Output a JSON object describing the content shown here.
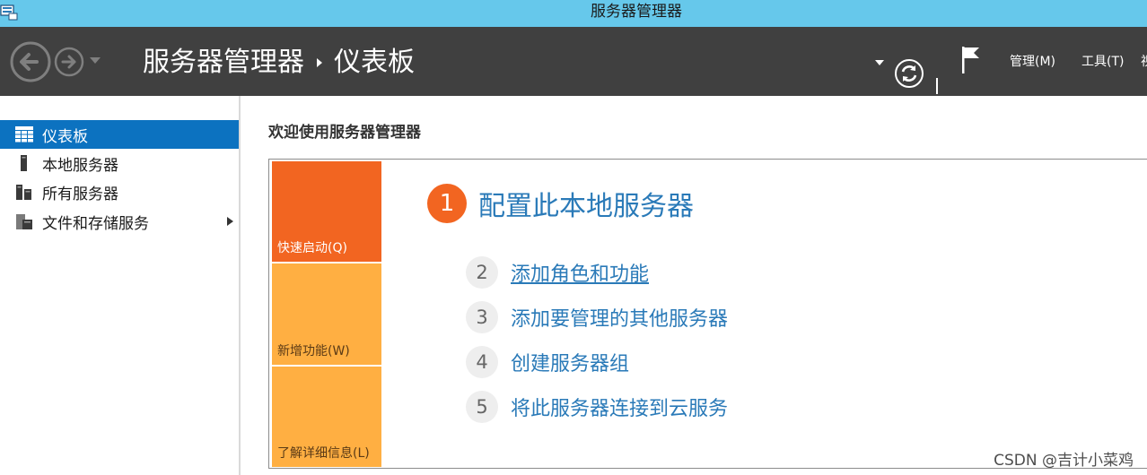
{
  "window": {
    "title": "服务器管理器"
  },
  "header": {
    "breadcrumb_root": "服务器管理器",
    "breadcrumb_current": "仪表板",
    "menu": {
      "manage": "管理(M)",
      "tools": "工具(T)",
      "view": "视"
    },
    "icons": [
      "back-arrow-icon",
      "forward-arrow-icon",
      "chevron-down-icon",
      "refresh-icon",
      "flag-icon"
    ]
  },
  "sidebar": {
    "items": [
      {
        "label": "仪表板",
        "icon": "dashboard-icon",
        "active": true
      },
      {
        "label": "本地服务器",
        "icon": "server-icon",
        "active": false
      },
      {
        "label": "所有服务器",
        "icon": "servers-icon",
        "active": false
      },
      {
        "label": "文件和存储服务",
        "icon": "storage-icon",
        "active": false,
        "expandable": true
      }
    ]
  },
  "main": {
    "welcome": "欢迎使用服务器管理器",
    "tiles": {
      "quickstart": "快速启动(Q)",
      "new_features": "新增功能(W)",
      "learn_more": "了解详细信息(L)"
    },
    "steps": [
      {
        "number": "1",
        "label": "配置此本地服务器"
      },
      {
        "number": "2",
        "label": "添加角色和功能"
      },
      {
        "number": "3",
        "label": "添加要管理的其他服务器"
      },
      {
        "number": "4",
        "label": "创建服务器组"
      },
      {
        "number": "5",
        "label": "将此服务器连接到云服务"
      }
    ]
  },
  "watermark": "CSDN @吉计小菜鸡",
  "colors": {
    "titlebar": "#66c8eb",
    "header": "#404040",
    "active_nav": "#0c72c0",
    "tile_primary": "#f26521",
    "tile_secondary": "#ffaf42",
    "link": "#2a7ab8"
  }
}
